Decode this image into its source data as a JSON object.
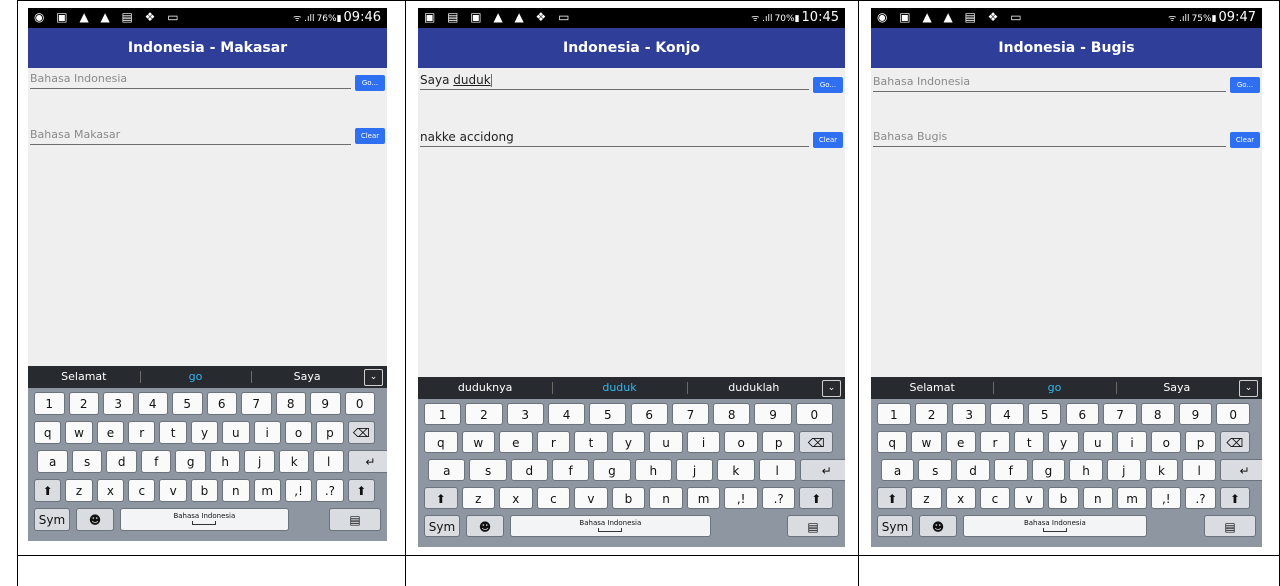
{
  "panels": [
    {
      "status_icons": "◉ ▣ ▲ ▲ ▤ ❖ ▭",
      "signal": "ᯤ .ıll",
      "battery": "76%▮",
      "time": "09:46",
      "title": "Indonesia - Makasar",
      "input": {
        "placeholder": "Bahasa Indonesia",
        "value_pre": "",
        "value_underlined": ""
      },
      "go_label": "Go...",
      "output": {
        "placeholder": "Bahasa Makasar",
        "value": ""
      },
      "clear_label": "Clear",
      "suggestions": [
        "Selamat",
        "go",
        "Saya"
      ]
    },
    {
      "status_icons": "▣ ▤ ▣ ▲ ▲ ❖ ▭",
      "signal": "ᯤ .ıll",
      "battery": "70%▮",
      "time": "10:45",
      "title": "Indonesia - Konjo",
      "input": {
        "placeholder": "",
        "value_pre": "Saya ",
        "value_underlined": "duduk"
      },
      "go_label": "Go...",
      "output": {
        "placeholder": "",
        "value": "nakke accidong"
      },
      "clear_label": "Clear",
      "suggestions": [
        "duduknya",
        "duduk",
        "duduklah"
      ]
    },
    {
      "status_icons": "◉ ▣ ▲ ▲ ▤ ❖ ▭",
      "signal": "ᯤ .ıll",
      "battery": "75%▮",
      "time": "09:47",
      "title": "Indonesia - Bugis",
      "input": {
        "placeholder": "Bahasa Indonesia",
        "value_pre": "",
        "value_underlined": ""
      },
      "go_label": "Go...",
      "output": {
        "placeholder": "Bahasa Bugis",
        "value": ""
      },
      "clear_label": "Clear",
      "suggestions": [
        "Selamat",
        "go",
        "Saya"
      ]
    }
  ],
  "keyboard": {
    "rows": [
      [
        "1",
        "2",
        "3",
        "4",
        "5",
        "6",
        "7",
        "8",
        "9",
        "0"
      ],
      [
        "q",
        "w",
        "e",
        "r",
        "t",
        "y",
        "u",
        "i",
        "o",
        "p",
        "⌫"
      ],
      [
        "a",
        "s",
        "d",
        "f",
        "g",
        "h",
        "j",
        "k",
        "l",
        "↵"
      ],
      [
        "⬆",
        "z",
        "x",
        "c",
        "v",
        "b",
        "n",
        "m",
        ",!",
        ".?",
        "⬆"
      ]
    ],
    "sym_label": "Sym",
    "emoji_icon": "☻",
    "space_label": "Bahasa Indonesia",
    "clipboard_icon": "▤"
  },
  "colors": {
    "appbar": "#2f3f99",
    "button": "#2f6ff2",
    "suggestion_bar": "#272b30",
    "suggestion_highlight": "#35b6f0",
    "keyboard_bg": "#8e96a1"
  }
}
